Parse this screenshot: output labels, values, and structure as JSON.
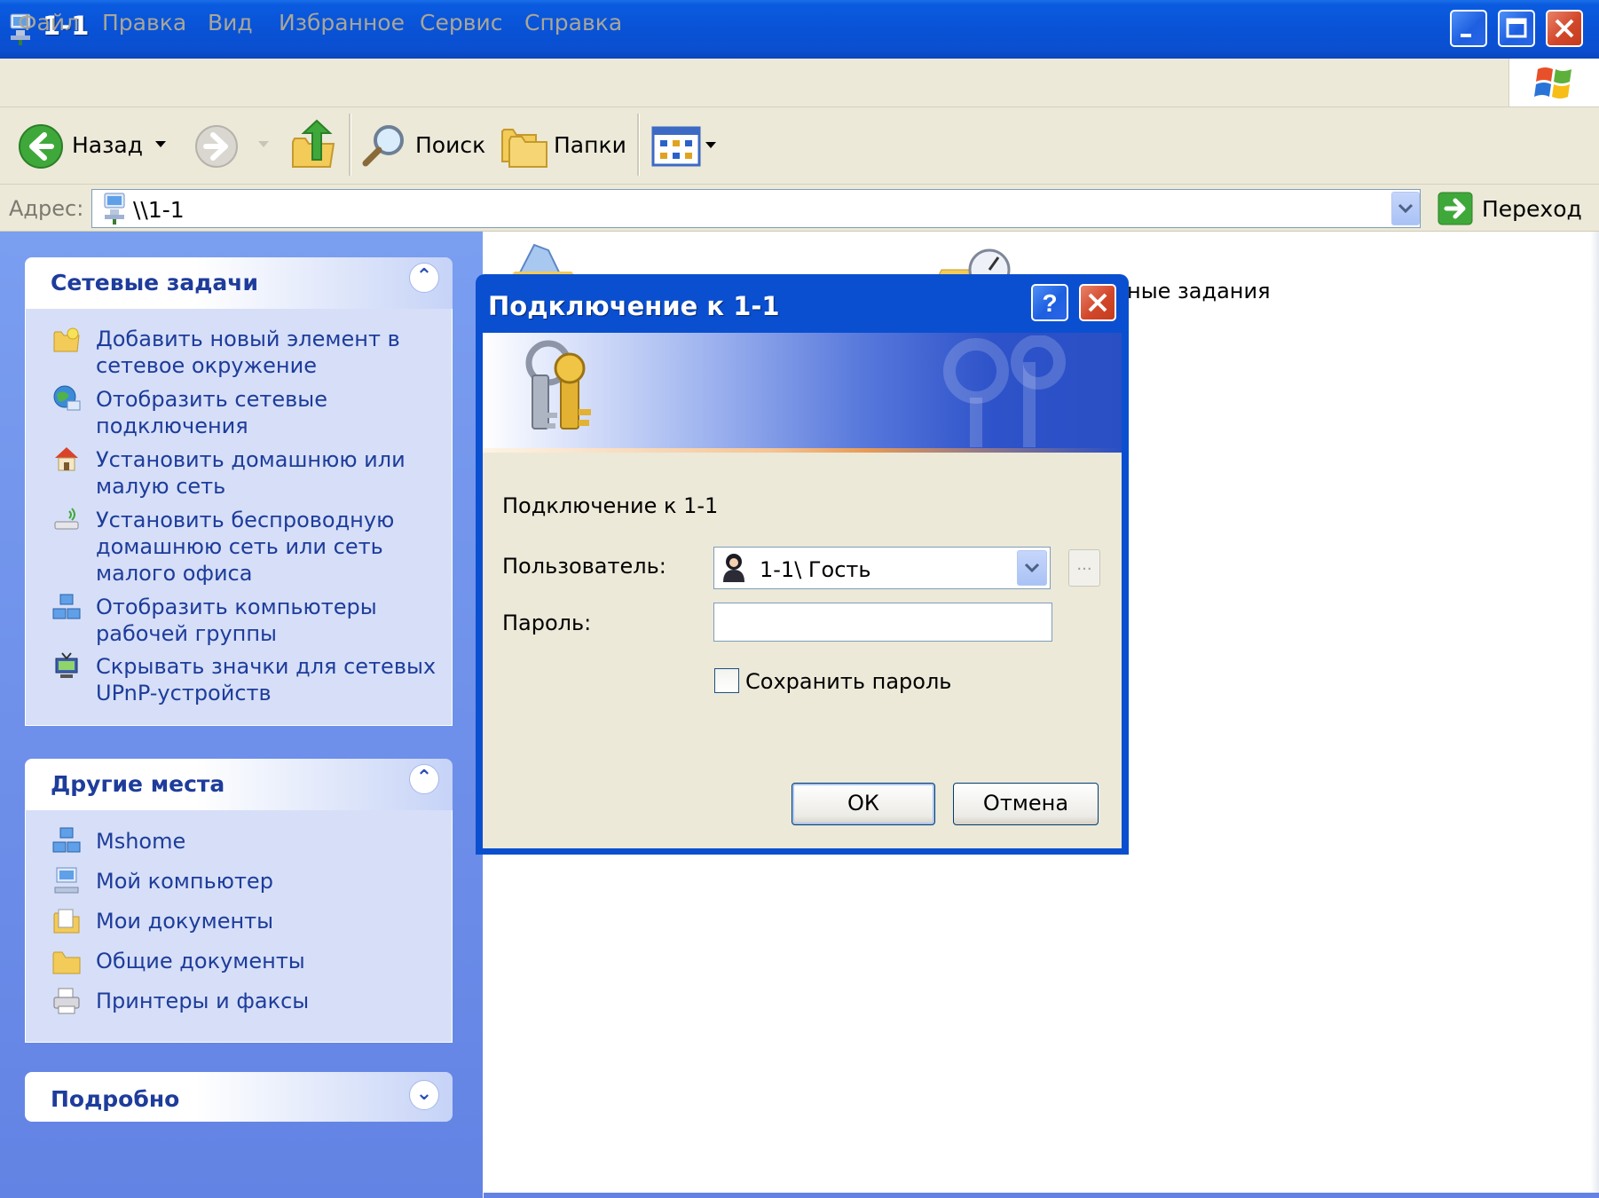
{
  "window": {
    "title": "1-1"
  },
  "menu": {
    "items": [
      "Файл",
      "Правка",
      "Вид",
      "Избранное",
      "Сервис",
      "Справка"
    ]
  },
  "toolbar": {
    "back_label": "Назад",
    "search_label": "Поиск",
    "folders_label": "Папки"
  },
  "address": {
    "label": "Адрес:",
    "value": "\\\\1-1",
    "go_label": "Переход"
  },
  "leftpane": {
    "network_tasks": {
      "title": "Сетевые задачи",
      "items": [
        {
          "label": "Добавить новый элемент в сетевое окружение",
          "icon": "add-network-place-icon"
        },
        {
          "label": "Отобразить сетевые подключения",
          "icon": "network-connections-icon"
        },
        {
          "label": "Установить домашнюю или малую сеть",
          "icon": "home-network-icon"
        },
        {
          "label": "Установить беспроводную домашнюю сеть или сеть малого офиса",
          "icon": "wireless-network-icon"
        },
        {
          "label": "Отобразить компьютеры рабочей группы",
          "icon": "workgroup-computers-icon"
        },
        {
          "label": "Скрывать значки для сетевых UPnP-устройств",
          "icon": "upnp-device-icon"
        }
      ]
    },
    "other_places": {
      "title": "Другие места",
      "items": [
        {
          "label": "Mshome",
          "icon": "workgroup-icon"
        },
        {
          "label": "Мой компьютер",
          "icon": "my-computer-icon"
        },
        {
          "label": "Мои документы",
          "icon": "my-documents-icon"
        },
        {
          "label": "Общие документы",
          "icon": "shared-documents-folder-icon"
        },
        {
          "label": "Принтеры и факсы",
          "icon": "printers-faxes-icon"
        }
      ]
    },
    "details": {
      "title": "Подробно"
    }
  },
  "main": {
    "visible_item_label": "ные задания"
  },
  "dialog": {
    "title": "Подключение к 1-1",
    "message": "Подключение к 1-1",
    "user_label": "Пользователь:",
    "user_value": "1-1\\ Гость",
    "password_label": "Пароль:",
    "password_value": "",
    "save_password_label": "Сохранить пароль",
    "save_password_checked": false,
    "ok_label": "ОК",
    "cancel_label": "Отмена",
    "browse_label": "..."
  },
  "colors": {
    "titlebar": "#0a52d6",
    "leftpane": "#6f91ea",
    "link": "#1e3c9b",
    "dialog_face": "#ece9d8"
  }
}
